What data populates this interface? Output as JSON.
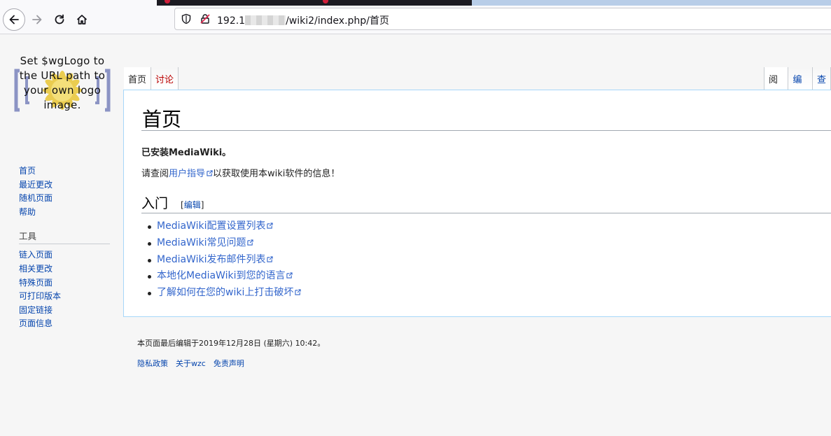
{
  "browser": {
    "url_prefix": "192.1",
    "url_suffix": "/wiki2/index.php/首页"
  },
  "logo": {
    "text": "Set $wgLogo to the URL path to your own logo image."
  },
  "sidebar": {
    "nav": [
      "首页",
      "最近更改",
      "随机页面",
      "帮助"
    ],
    "tools_heading": "工具",
    "tools": [
      "链入页面",
      "相关更改",
      "特殊页面",
      "可打印版本",
      "固定链接",
      "页面信息"
    ]
  },
  "tabs": {
    "left": [
      "首页",
      "讨论"
    ],
    "right": [
      "阅读",
      "编辑",
      "查"
    ]
  },
  "content": {
    "title": "首页",
    "installed": "已安装MediaWiki。",
    "intro_before": "请查阅",
    "intro_link": "用户指导",
    "intro_after": "以获取使用本wiki软件的信息！",
    "section_title": "入门",
    "section_edit_open": "[",
    "section_edit": "编辑",
    "section_edit_close": "]",
    "links": [
      "MediaWiki配置设置列表",
      "MediaWiki常见问题",
      "MediaWiki发布邮件列表",
      "本地化MediaWiki到您的语言",
      "了解如何在您的wiki上打击破坏"
    ]
  },
  "footer": {
    "last_edit": "本页面最后编辑于2019年12月28日 (星期六) 10:42。",
    "links": [
      "隐私政策",
      "关于wzc",
      "免责声明"
    ]
  }
}
